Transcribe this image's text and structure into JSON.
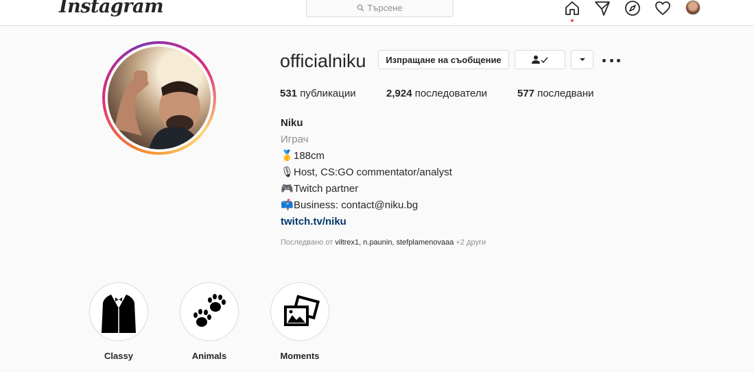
{
  "header": {
    "logo": "Instagram",
    "search_placeholder": "Търсене",
    "icons": [
      "home-icon",
      "direct-icon",
      "explore-icon",
      "activity-icon",
      "profile-avatar"
    ]
  },
  "profile": {
    "username": "officialniku",
    "message_button": "Изпращане на съобщение",
    "stats": {
      "posts_count": "531",
      "posts_label": "публикации",
      "followers_count": "2,924",
      "followers_label": "последователи",
      "following_count": "577",
      "following_label": "последвани"
    },
    "bio": {
      "name": "Niku",
      "category": "Играч",
      "lines": [
        {
          "icon": "🥇",
          "text": "188cm"
        },
        {
          "icon": "🎙",
          "text": "Host, CS:GO commentator/analyst"
        },
        {
          "icon": "🎮",
          "text": "Twitch partner"
        },
        {
          "icon": "📫",
          "text": "Business: contact@niku.bg"
        }
      ],
      "link": "twitch.tv/niku"
    },
    "followed_by": {
      "prefix": "Последвано от",
      "names": "viltrex1, n.paunin, stefplamenovaaa",
      "suffix": "+2 други"
    }
  },
  "highlights": [
    {
      "label": "Classy",
      "icon": "tuxedo-icon"
    },
    {
      "label": "Animals",
      "icon": "paw-prints-icon"
    },
    {
      "label": "Moments",
      "icon": "photos-icon"
    }
  ],
  "colors": {
    "background": "#fafafa",
    "border": "#dbdbdb",
    "text": "#262626",
    "muted": "#8e8e8e",
    "link": "#00376b",
    "notification_dot": "#ed4956"
  }
}
